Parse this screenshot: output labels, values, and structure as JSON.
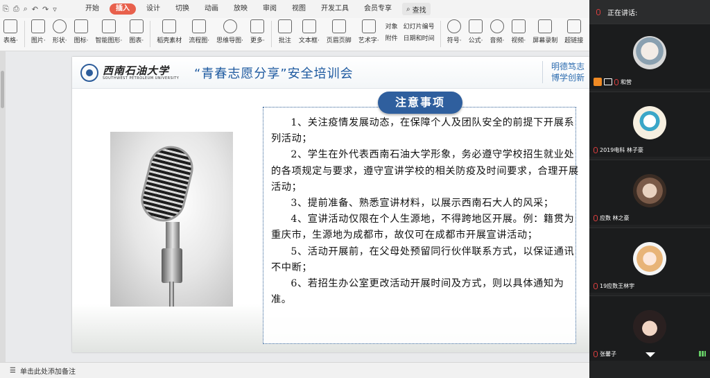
{
  "ribbon": {
    "tabs": [
      {
        "label": "开始"
      },
      {
        "label": "插入",
        "active": true
      },
      {
        "label": "设计"
      },
      {
        "label": "切换"
      },
      {
        "label": "动画"
      },
      {
        "label": "放映"
      },
      {
        "label": "审阅"
      },
      {
        "label": "视图"
      },
      {
        "label": "开发工具"
      },
      {
        "label": "会员专享"
      }
    ],
    "search_label": "查找",
    "tools": [
      {
        "label": "表格·"
      },
      {
        "label": "图片·"
      },
      {
        "label": "形状·"
      },
      {
        "label": "图标·"
      },
      {
        "label": "智能图形·"
      },
      {
        "label": "图表·"
      },
      {
        "label": "稻壳素材"
      },
      {
        "label": "流程图·"
      },
      {
        "label": "思维导图·"
      },
      {
        "label": "更多·"
      },
      {
        "label": "批注"
      },
      {
        "label": "文本框·"
      },
      {
        "label": "页眉页脚"
      },
      {
        "label": "艺术字·"
      }
    ],
    "small_tools": [
      {
        "label": "对象"
      },
      {
        "label": "附件"
      },
      {
        "label": "幻灯片编号"
      },
      {
        "label": "日期和时间"
      }
    ],
    "tools2": [
      {
        "label": "符号·"
      },
      {
        "label": "公式·"
      },
      {
        "label": "音频·"
      },
      {
        "label": "视频·"
      },
      {
        "label": "屏幕录制"
      },
      {
        "label": "超链接"
      }
    ]
  },
  "slide": {
    "logo_cn": "西南石油大学",
    "logo_en": "SOUTHWEST PETROLEUM UNIVERSITY",
    "title": "“青春志愿分享”安全培训会",
    "motto_line1": "明德笃志",
    "motto_line2": "博学创新",
    "notice_title": "注意事项",
    "items": [
      "1、关注疫情发展动态，在保障个人及团队安全的前提下开展系列活动；",
      "2、学生在外代表西南石油大学形象，务必遵守学校招生就业处的各项规定与要求，遵守宣讲学校的相关防疫及时间要求，合理开展活动；",
      "3、提前准备、熟悉宣讲材料，以展示西南石大人的风采；",
      "4、宣讲活动仅限在个人生源地，不得跨地区开展。例：籍贯为重庆市，生源地为成都市，故仅可在成都市开展宣讲活动；",
      "5、活动开展前，在父母处预留同行伙伴联系方式，以保证通讯不中断；",
      "6、若招生办公室更改活动开展时间及方式，则以具体通知为准。"
    ]
  },
  "notes_bar": {
    "label": "单击此处添加备注"
  },
  "meeting": {
    "header": "正在讲话:",
    "participants": [
      {
        "name": "和营"
      },
      {
        "name": "2019电科 林子豪"
      },
      {
        "name": "应数 林之豪"
      },
      {
        "name": "19应数王林宇"
      },
      {
        "name": "张馨子"
      }
    ]
  }
}
